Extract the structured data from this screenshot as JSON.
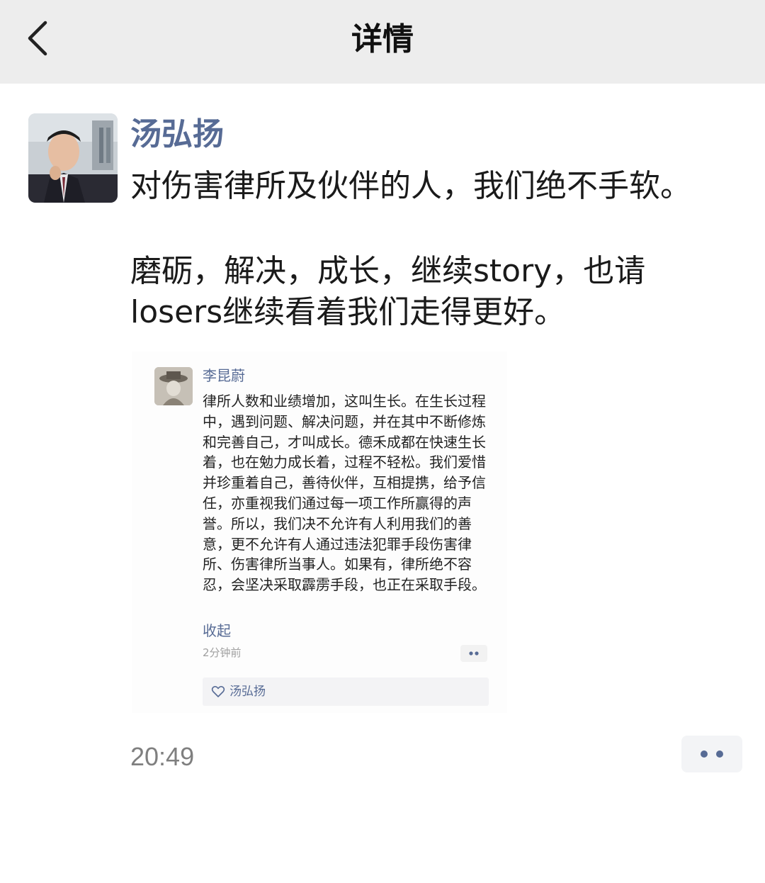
{
  "header": {
    "title": "详情",
    "back_icon": "chevron-left-icon"
  },
  "post": {
    "author": "汤弘扬",
    "lines": [
      "对伤害律所及伙伴的人，我们绝不手软。",
      "磨砺，解决，成长，继续story，也请",
      "losers继续看着我们走得更好。"
    ],
    "time": "20:49",
    "more_icon": "ellipsis-icon"
  },
  "screenshot": {
    "author": "李昆蔚",
    "body": "律所人数和业绩增加，这叫生长。在生长过程中，遇到问题、解决问题，并在其中不断修炼和完善自己，才叫成长。德禾成都在快速生长着，也在勉力成长着，过程不轻松。我们爱惜并珍重着自己，善待伙伴，互相提携，给予信任，亦重视我们通过每一项工作所赢得的声誉。所以，我们决不允许有人利用我们的善意，更不允许有人通过违法犯罪手段伤害律所、伤害律所当事人。如果有，律所绝不容忍，会坚决采取霹雳手段，也正在采取手段。",
    "collapse": "收起",
    "time": "2分钟前",
    "liker": "汤弘扬",
    "like_icon": "heart-outline-icon"
  },
  "colors": {
    "author_blue": "#576b95",
    "header_bg": "#ededed",
    "time_gray": "#7f7f7f"
  }
}
